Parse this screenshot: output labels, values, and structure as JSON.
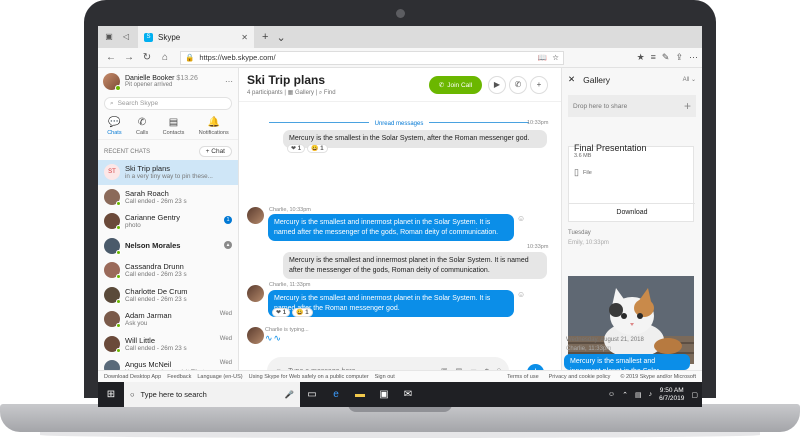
{
  "browser": {
    "tab_title": "Skype",
    "url": "https://web.skype.com/"
  },
  "profile": {
    "name": "Danielle Booker",
    "amount": "$13.26",
    "status": "Pit opener arrived"
  },
  "search_placeholder": "Search Skype",
  "nav": [
    {
      "label": "Chats",
      "icon": "chat-icon",
      "badge": "2"
    },
    {
      "label": "Calls",
      "icon": "phone-icon"
    },
    {
      "label": "Contacts",
      "icon": "contacts-icon"
    },
    {
      "label": "Notifications",
      "icon": "bell-icon"
    }
  ],
  "recent_label": "RECENT CHATS",
  "new_chat_label": "+ Chat",
  "chats": [
    {
      "name": "Ski Trip plans",
      "sub": "in a very tiny way to pin these...",
      "meta": "",
      "initials": "ST",
      "selected": true
    },
    {
      "name": "Sarah Roach",
      "sub": "Call ended - 26m 23 s",
      "meta": "",
      "color": "#8b6a5a"
    },
    {
      "name": "Carianne Gentry",
      "sub": "photo",
      "meta": "",
      "badge": "1",
      "color": "#6b4a3a"
    },
    {
      "name": "Nelson Morales",
      "sub": "",
      "meta": "",
      "badge": "grey",
      "bold": true,
      "color": "#4a5a6a"
    },
    {
      "name": "Cassandra Drunn",
      "sub": "Call ended - 26m 23 s",
      "meta": "",
      "color": "#9a6a5a"
    },
    {
      "name": "Charlotte De Crum",
      "sub": "Call ended - 26m 23 s",
      "meta": "",
      "color": "#5a4a3a"
    },
    {
      "name": "Adam Jarman",
      "sub": "Ask you",
      "meta": "Wed",
      "color": "#7a5a4a"
    },
    {
      "name": "Will Little",
      "sub": "Call ended - 26m 23 s",
      "meta": "Wed",
      "color": "#6a4a3a"
    },
    {
      "name": "Angus McNeil",
      "sub": "You need a visa to visit Tibet...",
      "meta": "Wed",
      "color": "#5a6a7a"
    }
  ],
  "conversation": {
    "title": "Ski Trip plans",
    "participants": "4 participants",
    "gallery": "Gallery",
    "find": "Find",
    "join_call": "Join Call",
    "unread": "Unread messages",
    "messages": [
      {
        "time": "10:33pm",
        "text": "Mercury is the smallest in the Solar System, after the Roman messenger god."
      },
      {
        "sender": "Charlie, 10:33pm",
        "text": "Mercury is the smallest and innermost planet in the Solar System. It is named after the messenger of the gods, Roman deity of communication."
      },
      {
        "time": "10:33pm",
        "text": "Mercury is the smallest and innermost planet in the Solar System. It is named after the messenger of the gods, Roman deity of communication."
      },
      {
        "sender": "Charlie, 11:33pm",
        "text": "Mercury is the smallest and innermost planet in the Solar System. It is named after the Roman messenger god."
      }
    ],
    "reactions_1": [
      "1",
      "1"
    ],
    "reactions_2": [
      "1",
      "1"
    ],
    "typing": "Charlie is typing...",
    "composer_placeholder": "Type a message here"
  },
  "gallery": {
    "title": "Gallery",
    "filter": "All",
    "drop": "Drop here to share",
    "file_title": "Final Presentation",
    "file_size": "3.6 MB",
    "file_type": "File",
    "download": "Download",
    "date_1": "Tuesday",
    "sender_1": "Emily, 10:33pm",
    "date_2": "Wednesday, August 21, 2018",
    "sender_2": "Charlie, 11:33pm",
    "msg": "Mercury is the smallest and innermost planet in the Solar System."
  },
  "footer": {
    "links": [
      "Download Desktop App",
      "Feedback",
      "Language (en-US)",
      "Using Skype for Web safely on a public computer",
      "Sign out"
    ],
    "right": [
      "Terms of use",
      "Privacy and cookie policy",
      "© 2019 Skype and/or Microsoft"
    ]
  },
  "taskbar": {
    "search": "Type here to search",
    "time": "9:50 AM",
    "date": "6/7/2019"
  }
}
